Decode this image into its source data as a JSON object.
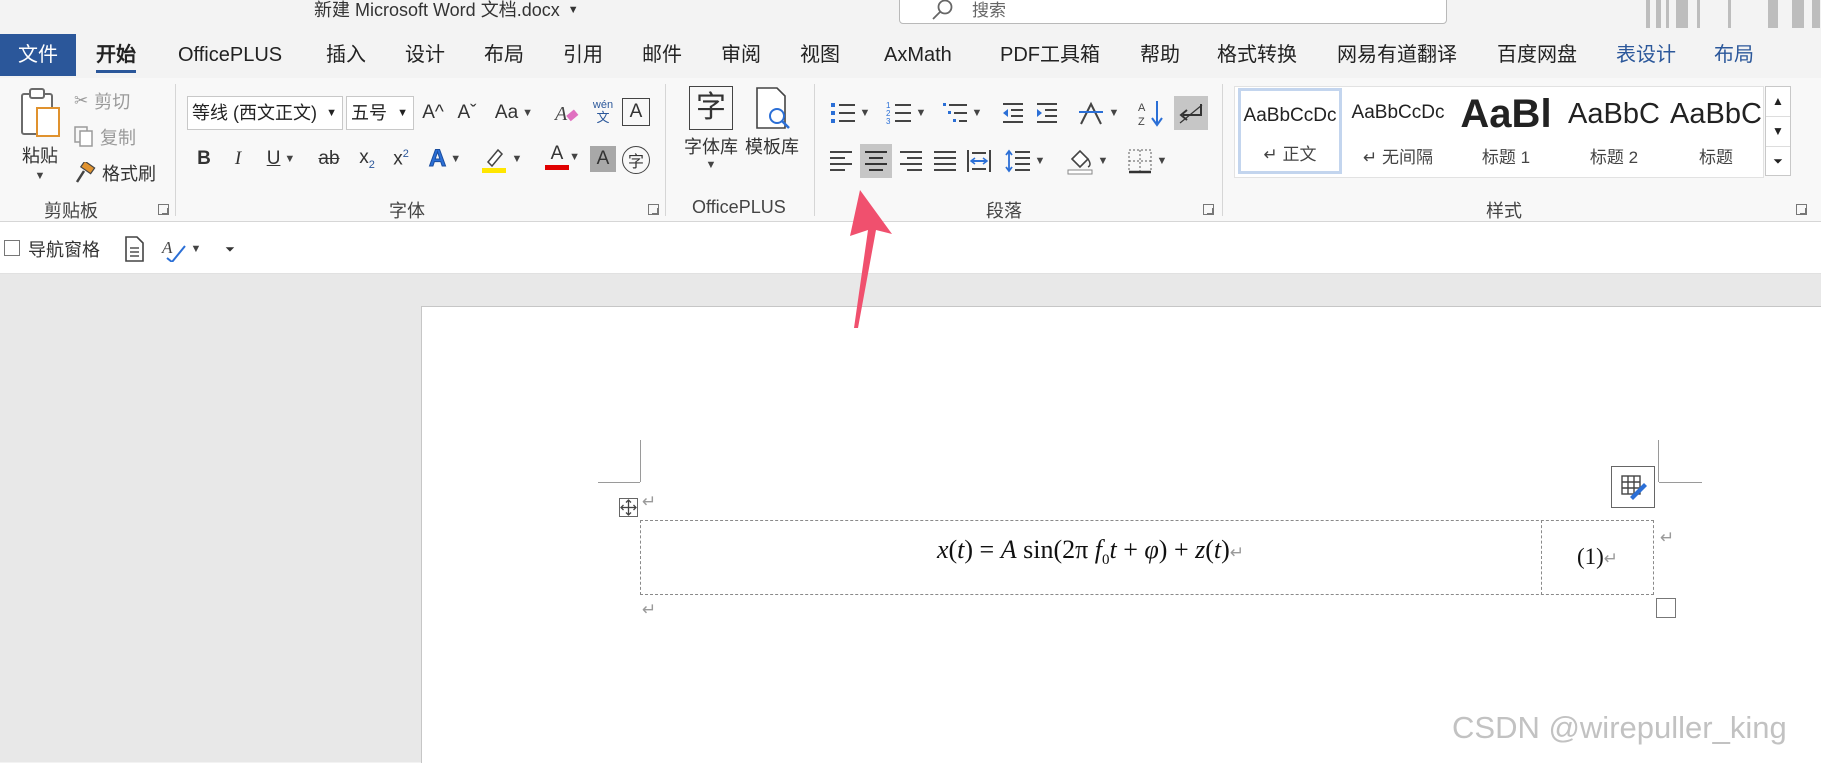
{
  "window": {
    "title": "新建 Microsoft Word 文档.docx",
    "search_placeholder": "搜索"
  },
  "menu": {
    "file": "文件",
    "home": "开始",
    "officeplus": "OfficePLUS",
    "insert": "插入",
    "design": "设计",
    "layout": "布局",
    "references": "引用",
    "mailings": "邮件",
    "review": "审阅",
    "view": "视图",
    "axmath": "AxMath",
    "pdf": "PDF工具箱",
    "help": "帮助",
    "convert": "格式转换",
    "youdao": "网易有道翻译",
    "baidu": "百度网盘",
    "table_design": "表设计",
    "table_layout": "布局"
  },
  "clipboard": {
    "paste": "粘贴",
    "cut": "剪切",
    "copy": "复制",
    "format_painter": "格式刷",
    "label": "剪贴板"
  },
  "font": {
    "font_name": "等线 (西文正文)",
    "font_size": "五号",
    "grow": "A^",
    "shrink": "Aˇ",
    "change_case": "Aa",
    "label": "字体",
    "bold": "B",
    "italic": "I",
    "underline": "U",
    "strike": "ab",
    "phonetic_top": "wén",
    "phonetic_bottom": "文",
    "char_border": "A",
    "text_effect": "A",
    "font_color": "A",
    "char_shading": "A",
    "enclose": "字",
    "highlight_color": "#ffe600",
    "font_color_value": "#e00000"
  },
  "officeplus_group": {
    "font_lib": "字体库",
    "template_lib": "模板库",
    "font_lib_glyph": "字",
    "label": "OfficePLUS"
  },
  "paragraph": {
    "label": "段落"
  },
  "styles": {
    "label": "样式",
    "items": [
      {
        "sample": "AaBbCcDc",
        "name": "↵ 正文"
      },
      {
        "sample": "AaBbCcDc",
        "name": "↵ 无间隔"
      },
      {
        "sample": "AaBl",
        "name": "标题 1"
      },
      {
        "sample": "AaBbC",
        "name": "标题 2"
      },
      {
        "sample": "AaBbC",
        "name": "标题"
      }
    ]
  },
  "quick_access": {
    "nav_pane": "导航窗格"
  },
  "document": {
    "equation_lhs": "x(t) = A sin(2π f",
    "equation_number": "(1)",
    "paragraph_mark": "↵"
  },
  "watermark": "CSDN @wirepuller_king",
  "colors": {
    "accent": "#2b579a",
    "arrow": "#f0506e"
  }
}
